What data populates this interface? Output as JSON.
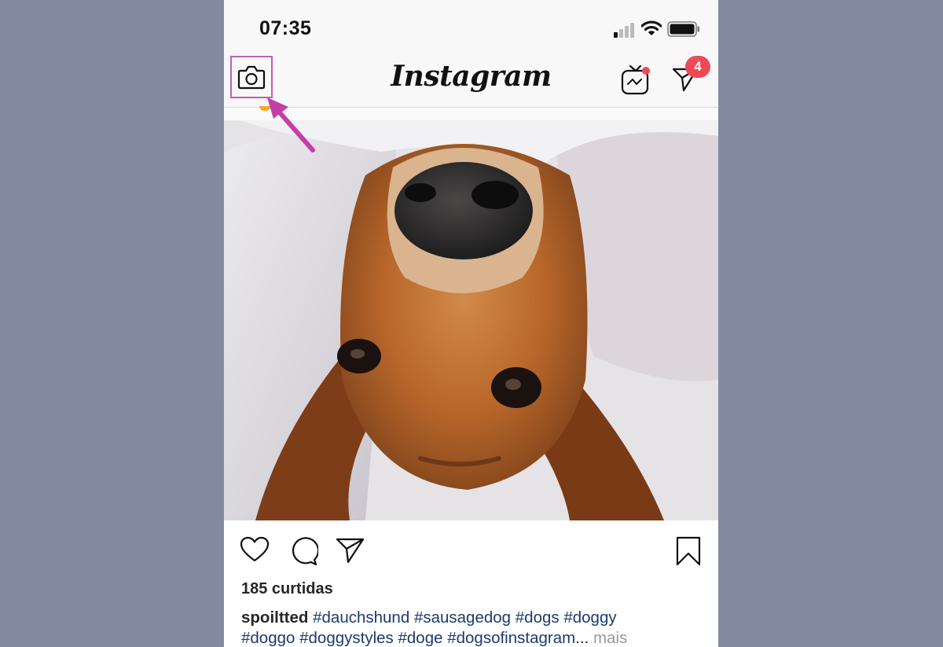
{
  "status_bar": {
    "time": "07:35"
  },
  "header": {
    "logo": "Instagram",
    "direct_badge": "4"
  },
  "post": {
    "likes": "185 curtidas",
    "username": "spoiltted",
    "hashtags_line1": [
      "#dauchshund",
      "#sausagedog",
      "#dogs",
      "#doggy"
    ],
    "hashtags_line2": [
      "#doggo",
      "#doggystyles",
      "#doge",
      "#dogsofinstagram"
    ],
    "ellipsis": "...",
    "more_label": "mais"
  },
  "colors": {
    "background": "#828a9f",
    "highlight": "#c55db5",
    "badge": "#ed4956",
    "hashtag": "#1e3a6e"
  },
  "icons": [
    "camera-icon",
    "igtv-icon",
    "direct-icon",
    "heart-icon",
    "comment-icon",
    "share-icon",
    "bookmark-icon",
    "signal-icon",
    "wifi-icon",
    "battery-icon"
  ]
}
